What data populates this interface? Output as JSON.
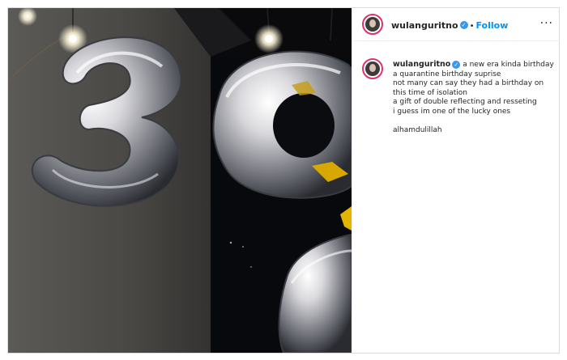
{
  "post": {
    "header": {
      "username": "wulanguritno",
      "verified_icon": "verified-badge-icon",
      "separator": "•",
      "follow_label": "Follow",
      "more_label": "···"
    },
    "caption": {
      "username": "wulanguritno",
      "lines": [
        "a new era kinda birthday",
        "a quarantine birthday suprise",
        "not many can say they had a birthday on this time of isolation",
        "a gift of double reflecting and resseting",
        "i guess im one of the lucky ones",
        "",
        "alhamdulillah"
      ]
    },
    "media": {
      "description_icon": "balloon-photo",
      "accent_color": "#d8a800"
    }
  },
  "colors": {
    "follow": "#0095f6",
    "verified": "#3897f0",
    "text": "#262626",
    "border": "#dbdbdb"
  }
}
